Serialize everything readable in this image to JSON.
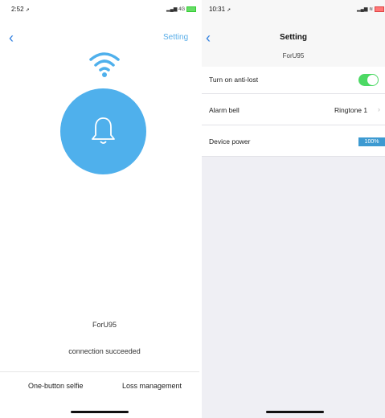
{
  "left_screen": {
    "status": {
      "time": "2:52",
      "network": "4G"
    },
    "nav": {
      "action_label": "Setting"
    },
    "device_name": "ForU95",
    "connection_status": "connection succeeded",
    "tabs": [
      "One-button selfie",
      "Loss management"
    ]
  },
  "right_screen": {
    "status": {
      "time": "10:31"
    },
    "nav": {
      "title": "Setting"
    },
    "device_name": "ForU95",
    "rows": {
      "anti_lost": {
        "label": "Turn on anti-lost",
        "enabled": true
      },
      "alarm_bell": {
        "label": "Alarm bell",
        "value": "Ringtone 1"
      },
      "device_power": {
        "label": "Device power",
        "value": "100%",
        "level": 1.0
      }
    }
  },
  "colors": {
    "accent_blue": "#4fb0ec",
    "link_blue": "#2f7fe0",
    "toggle_green": "#4cd964",
    "power_bar": "#3d9ad1"
  },
  "icons": [
    "back-chevron-icon",
    "wifi-icon",
    "bell-icon",
    "location-arrow-icon"
  ]
}
